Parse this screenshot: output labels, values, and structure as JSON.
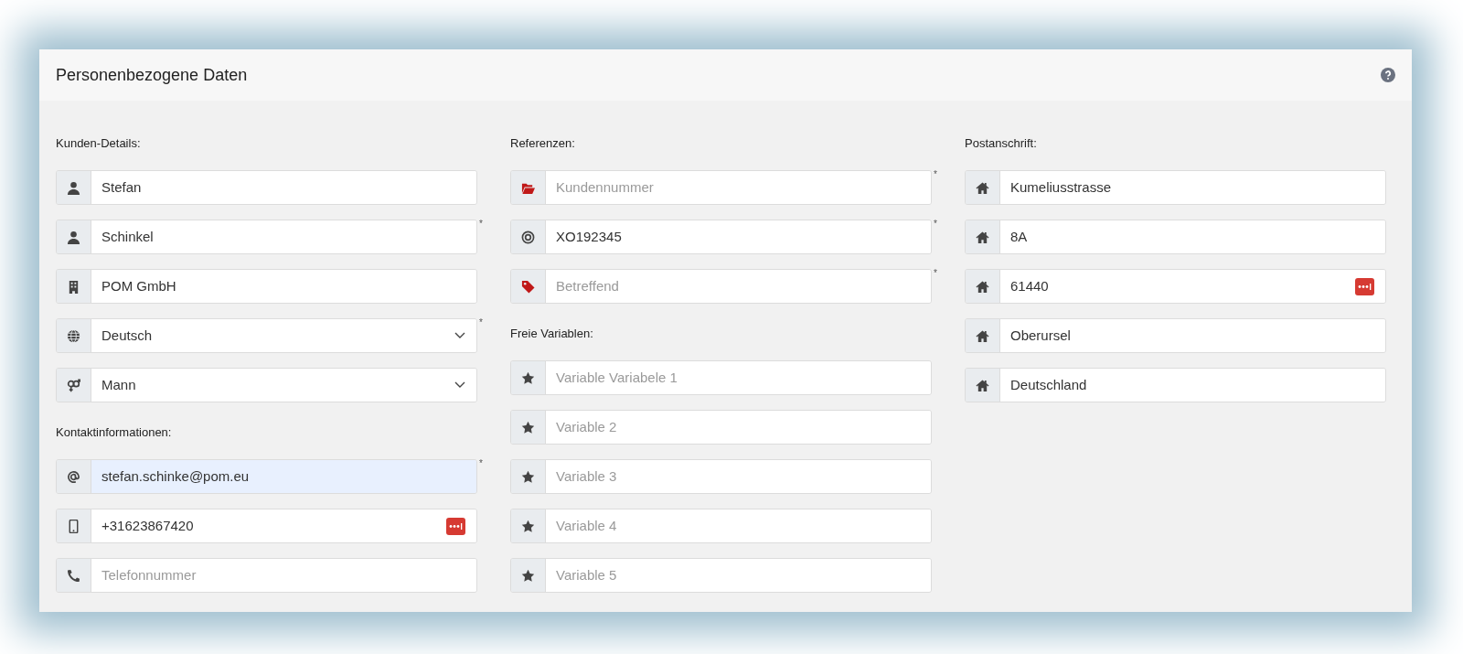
{
  "panel": {
    "title": "Personenbezogene Daten"
  },
  "columns": [
    [
      {
        "title": "Kunden-Details:",
        "fields": [
          {
            "kind": "text",
            "value": "Stefan"
          },
          {
            "kind": "text",
            "value": "Schinkel",
            "required_mark": "*"
          },
          {
            "kind": "text",
            "value": "POM GmbH"
          },
          {
            "kind": "select",
            "value": "Deutsch",
            "required_mark": "*"
          },
          {
            "kind": "select",
            "value": "Mann"
          }
        ]
      },
      {
        "title": "Kontaktinformationen:",
        "fields": [
          {
            "kind": "text",
            "value": "stefan.schinke@pom.eu",
            "required_mark": "*",
            "autofilled": true
          },
          {
            "kind": "text",
            "value": "+31623867420",
            "password_badge": true
          },
          {
            "kind": "text",
            "placeholder": "Telefonnummer"
          }
        ]
      }
    ],
    [
      {
        "title": "Referenzen:",
        "fields": [
          {
            "kind": "text",
            "placeholder": "Kundennummer",
            "required_mark": "*"
          },
          {
            "kind": "text",
            "value": "XO192345",
            "required_mark": "*"
          },
          {
            "kind": "text",
            "placeholder": "Betreffend",
            "required_mark": "*"
          }
        ]
      },
      {
        "title": "Freie Variablen:",
        "fields": [
          {
            "kind": "text",
            "placeholder": "Variable Variabele 1"
          },
          {
            "kind": "text",
            "placeholder": "Variable 2"
          },
          {
            "kind": "text",
            "placeholder": "Variable 3"
          },
          {
            "kind": "text",
            "placeholder": "Variable 4"
          },
          {
            "kind": "text",
            "placeholder": "Variable 5"
          }
        ]
      }
    ],
    [
      {
        "title": "Postanschrift:",
        "fields": [
          {
            "kind": "text",
            "value": "Kumeliusstrasse"
          },
          {
            "kind": "text",
            "value": "8A"
          },
          {
            "kind": "text",
            "value": "61440",
            "password_badge": true
          },
          {
            "kind": "text",
            "value": "Oberursel"
          },
          {
            "kind": "text",
            "value": "Deutschland"
          }
        ]
      }
    ]
  ]
}
